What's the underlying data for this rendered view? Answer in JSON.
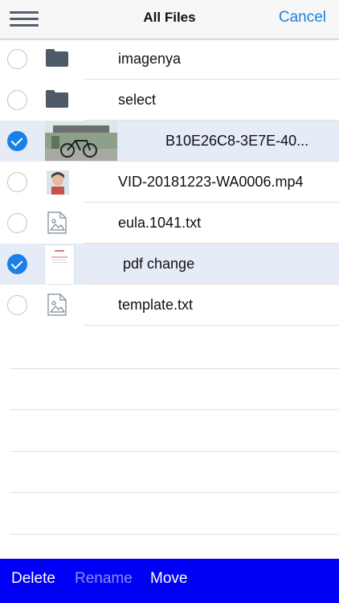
{
  "header": {
    "title": "All Files",
    "cancel_label": "Cancel"
  },
  "files": [
    {
      "name": "imagenya",
      "type": "folder",
      "selected": false
    },
    {
      "name": "select",
      "type": "folder",
      "selected": false
    },
    {
      "name": "B10E26C8-3E7E-40...",
      "type": "photo",
      "selected": true
    },
    {
      "name": "VID-20181223-WA0006.mp4",
      "type": "video",
      "selected": false
    },
    {
      "name": "eula.1041.txt",
      "type": "text",
      "selected": false
    },
    {
      "name": "pdf change",
      "type": "pdf",
      "selected": true
    },
    {
      "name": "template.txt",
      "type": "text",
      "selected": false
    }
  ],
  "footer": {
    "delete_label": "Delete",
    "rename_label": "Rename",
    "move_label": "Move"
  },
  "colors": {
    "accent": "#1a7fe8",
    "footer_bg": "#0000f5",
    "selected_row": "#e5ebf7"
  }
}
